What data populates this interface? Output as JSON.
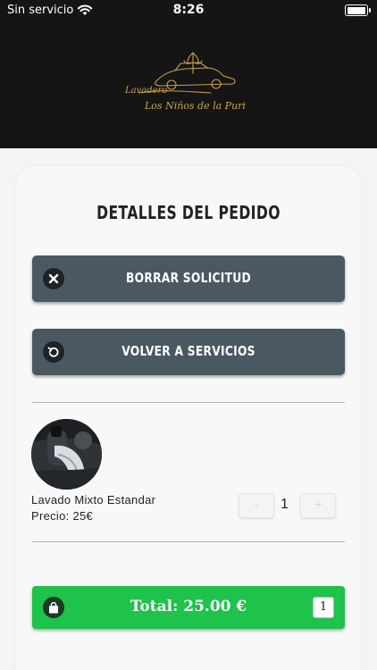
{
  "status_bar": {
    "carrier": "Sin servicio",
    "time": "8:26"
  },
  "header": {
    "logo_line1": "Lavadero",
    "logo_line2": "Los Niños de la Puri",
    "logo_color": "#c9a14a"
  },
  "page": {
    "title": "DETALLES DEL PEDIDO"
  },
  "actions": {
    "borrar_label": "BORRAR SOLICITUD",
    "volver_label": "VOLVER A SERVICIOS"
  },
  "cart": {
    "items": [
      {
        "name": "Lavado Mixto Estandar",
        "price": "Precio: 25€",
        "quantity": "1",
        "minus": "-",
        "plus": "+"
      }
    ]
  },
  "footer": {
    "total_label": "Total: 25.00 €",
    "item_count": "1",
    "accent": "#1fc24a"
  }
}
